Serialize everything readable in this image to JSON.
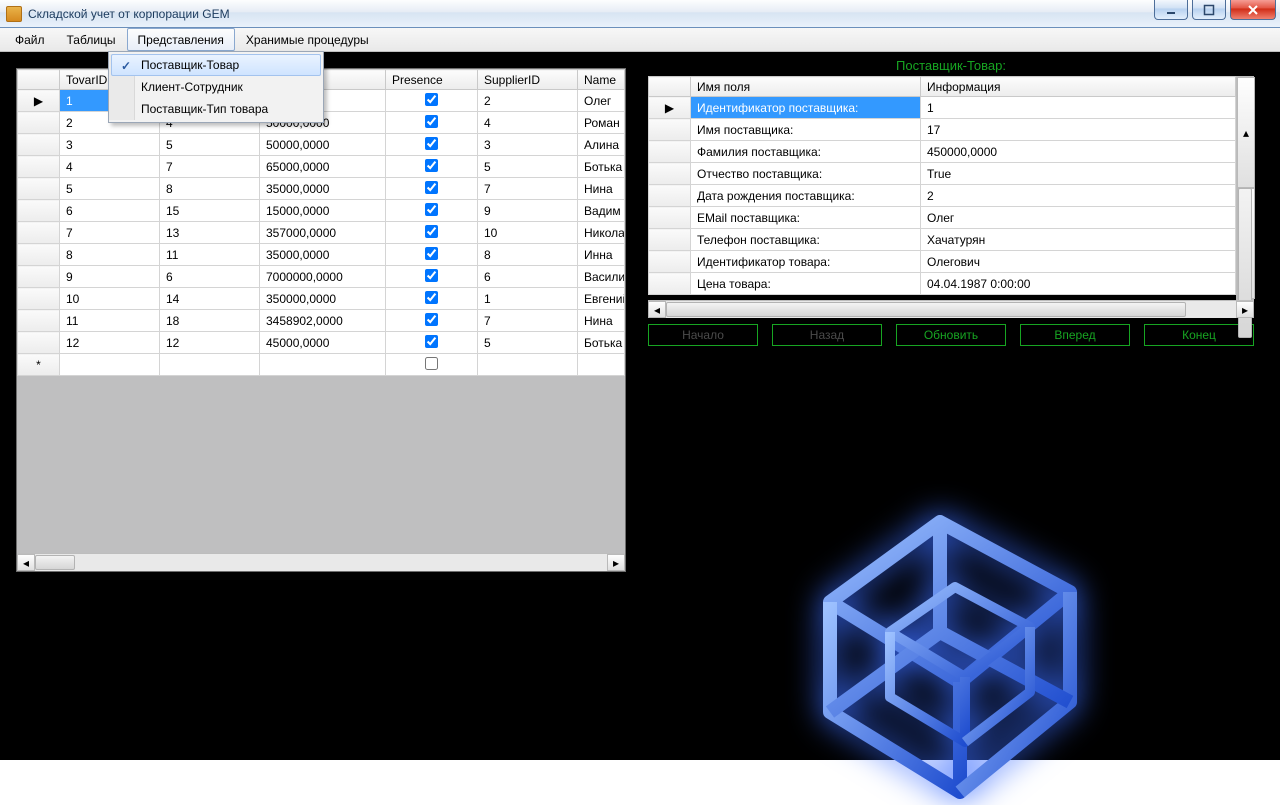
{
  "window": {
    "title": "Складской учет от корпорации GEM"
  },
  "menu": {
    "items": [
      "Файл",
      "Таблицы",
      "Представления",
      "Хранимые процедуры"
    ],
    "open_index": 2,
    "dropdown": [
      {
        "label": "Поставщик-Товар",
        "checked": true,
        "selected": true
      },
      {
        "label": "Клиент-Сотрудник",
        "checked": false,
        "selected": false
      },
      {
        "label": "Поставщик-Тип товара",
        "checked": false,
        "selected": false
      }
    ]
  },
  "left_grid": {
    "columns": [
      "TovarID",
      "",
      "",
      "Presence",
      "SupplierID",
      "Name"
    ],
    "rows": [
      {
        "sel": true,
        "mark": "▶",
        "c1": "1",
        "c2": "",
        "c3": "",
        "presence": true,
        "supplier": "2",
        "name": "Олег"
      },
      {
        "sel": false,
        "mark": "",
        "c1": "2",
        "c2": "4",
        "c3": "50000,0000",
        "presence": true,
        "supplier": "4",
        "name": "Роман"
      },
      {
        "sel": false,
        "mark": "",
        "c1": "3",
        "c2": "5",
        "c3": "50000,0000",
        "presence": true,
        "supplier": "3",
        "name": "Алина"
      },
      {
        "sel": false,
        "mark": "",
        "c1": "4",
        "c2": "7",
        "c3": "65000,0000",
        "presence": true,
        "supplier": "5",
        "name": "Ботька"
      },
      {
        "sel": false,
        "mark": "",
        "c1": "5",
        "c2": "8",
        "c3": "35000,0000",
        "presence": true,
        "supplier": "7",
        "name": "Нина"
      },
      {
        "sel": false,
        "mark": "",
        "c1": "6",
        "c2": "15",
        "c3": "15000,0000",
        "presence": true,
        "supplier": "9",
        "name": "Вадим"
      },
      {
        "sel": false,
        "mark": "",
        "c1": "7",
        "c2": "13",
        "c3": "357000,0000",
        "presence": true,
        "supplier": "10",
        "name": "Николай"
      },
      {
        "sel": false,
        "mark": "",
        "c1": "8",
        "c2": "11",
        "c3": "35000,0000",
        "presence": true,
        "supplier": "8",
        "name": "Инна"
      },
      {
        "sel": false,
        "mark": "",
        "c1": "9",
        "c2": "6",
        "c3": "7000000,0000",
        "presence": true,
        "supplier": "6",
        "name": "Василий"
      },
      {
        "sel": false,
        "mark": "",
        "c1": "10",
        "c2": "14",
        "c3": "350000,0000",
        "presence": true,
        "supplier": "1",
        "name": "Евгений"
      },
      {
        "sel": false,
        "mark": "",
        "c1": "11",
        "c2": "18",
        "c3": "3458902,0000",
        "presence": true,
        "supplier": "7",
        "name": "Нина"
      },
      {
        "sel": false,
        "mark": "",
        "c1": "12",
        "c2": "12",
        "c3": "45000,0000",
        "presence": true,
        "supplier": "5",
        "name": "Ботька"
      }
    ],
    "newrow_mark": "*"
  },
  "right": {
    "title": "Поставщик-Товар:",
    "columns": [
      "Имя поля",
      "Информация"
    ],
    "rows": [
      {
        "k": "Идентификатор поставщика:",
        "v": "1",
        "sel": true,
        "mark": "▶"
      },
      {
        "k": "Имя поставщика:",
        "v": "17"
      },
      {
        "k": "Фамилия поставщика:",
        "v": "450000,0000"
      },
      {
        "k": "Отчество поставщика:",
        "v": "True"
      },
      {
        "k": "Дата рождения поставщика:",
        "v": "2"
      },
      {
        "k": "EMail поставщика:",
        "v": "Олег"
      },
      {
        "k": "Телефон поставщика:",
        "v": "Хачатурян"
      },
      {
        "k": "Идентификатор товара:",
        "v": "Олегович"
      },
      {
        "k": "Цена товара:",
        "v": "04.04.1987 0:00:00"
      }
    ],
    "nav": {
      "first": "Начало",
      "prev": "Назад",
      "refresh": "Обновить",
      "next": "Вперед",
      "last": "Конец"
    }
  }
}
